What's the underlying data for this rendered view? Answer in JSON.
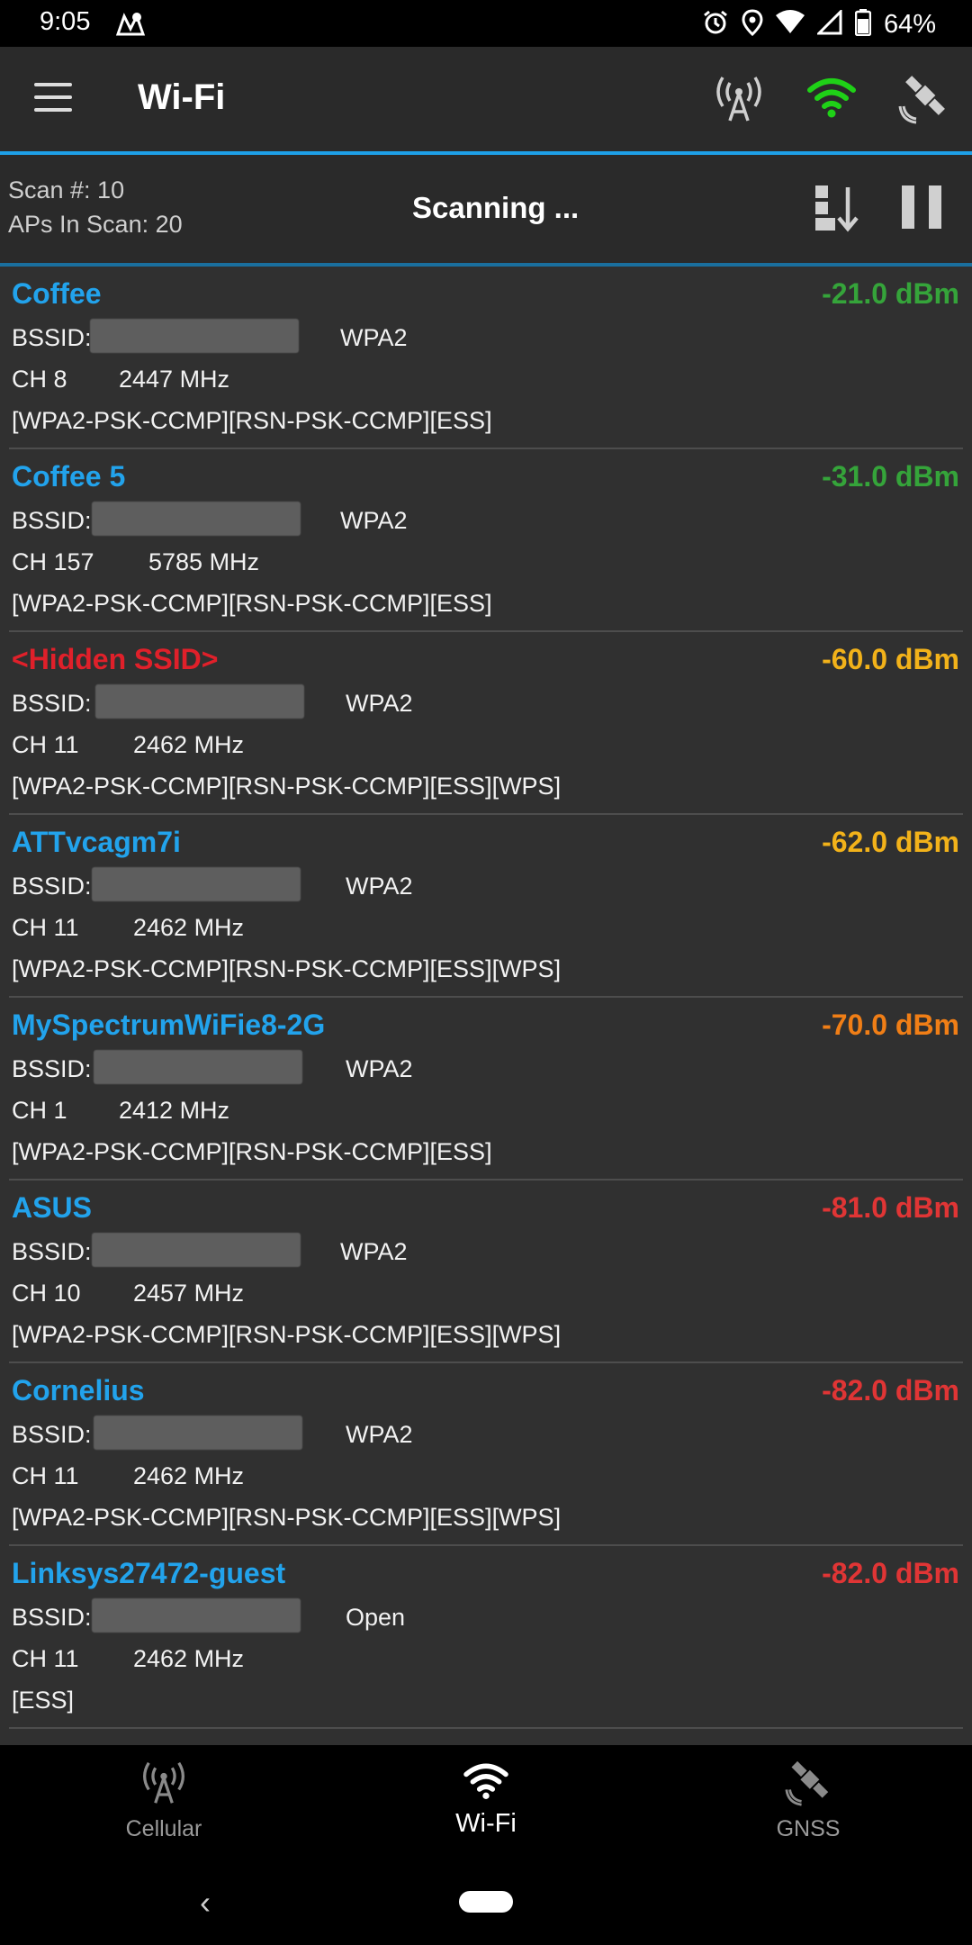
{
  "status_bar": {
    "time": "9:05",
    "battery": "64%",
    "icons": [
      "maps-icon",
      "alarm-icon",
      "location-icon",
      "wifi-icon",
      "signal-icon",
      "battery-icon"
    ]
  },
  "toolbar": {
    "title": "Wi-Fi",
    "icons": [
      "menu-icon",
      "cell-tower-icon",
      "wifi-icon",
      "satellite-icon"
    ],
    "wifi_color": "#1fd117"
  },
  "scan": {
    "scan_number": "Scan #: 10",
    "aps_in_scan": "APs In Scan: 20",
    "status": "Scanning ...",
    "icons": [
      "sort-icon",
      "pause-icon"
    ]
  },
  "colors": {
    "ssid": "#22a3ec",
    "hidden_ssid": "#e0202a",
    "strong": "#35a43a",
    "medium": "#f2b21a",
    "weak_orange": "#f07e16",
    "weak_red": "#e03535"
  },
  "access_points": [
    {
      "ssid": "Coffee",
      "dbm": "-21.0 dBm",
      "dbm_color": "#35a43a",
      "bssid_label": "BSSID:",
      "security": "WPA2",
      "channel": "CH 8",
      "frequency": "2447 MHz",
      "capabilities": "[WPA2-PSK-CCMP][RSN-PSK-CCMP][ESS]",
      "hidden": false
    },
    {
      "ssid": "Coffee 5",
      "dbm": "-31.0 dBm",
      "dbm_color": "#35a43a",
      "bssid_label": "BSSID:",
      "security": "WPA2",
      "channel": "CH 157",
      "frequency": "5785 MHz",
      "capabilities": "[WPA2-PSK-CCMP][RSN-PSK-CCMP][ESS]",
      "hidden": false
    },
    {
      "ssid": "<Hidden SSID>",
      "dbm": "-60.0 dBm",
      "dbm_color": "#f2b21a",
      "bssid_label": "BSSID:",
      "security": "WPA2",
      "channel": "CH 11",
      "frequency": "2462 MHz",
      "capabilities": "[WPA2-PSK-CCMP][RSN-PSK-CCMP][ESS][WPS]",
      "hidden": true
    },
    {
      "ssid": "ATTvcagm7i",
      "dbm": "-62.0 dBm",
      "dbm_color": "#f2b21a",
      "bssid_label": "BSSID:",
      "security": "WPA2",
      "channel": "CH 11",
      "frequency": "2462 MHz",
      "capabilities": "[WPA2-PSK-CCMP][RSN-PSK-CCMP][ESS][WPS]",
      "hidden": false
    },
    {
      "ssid": "MySpectrumWiFie8-2G",
      "dbm": "-70.0 dBm",
      "dbm_color": "#f07e16",
      "bssid_label": "BSSID:",
      "security": "WPA2",
      "channel": "CH 1",
      "frequency": "2412 MHz",
      "capabilities": "[WPA2-PSK-CCMP][RSN-PSK-CCMP][ESS]",
      "hidden": false
    },
    {
      "ssid": "ASUS",
      "dbm": "-81.0 dBm",
      "dbm_color": "#e03535",
      "bssid_label": "BSSID:",
      "security": "WPA2",
      "channel": "CH 10",
      "frequency": "2457 MHz",
      "capabilities": "[WPA2-PSK-CCMP][RSN-PSK-CCMP][ESS][WPS]",
      "hidden": false
    },
    {
      "ssid": "Cornelius",
      "dbm": "-82.0 dBm",
      "dbm_color": "#e03535",
      "bssid_label": "BSSID:",
      "security": "WPA2",
      "channel": "CH 11",
      "frequency": "2462 MHz",
      "capabilities": "[WPA2-PSK-CCMP][RSN-PSK-CCMP][ESS][WPS]",
      "hidden": false
    },
    {
      "ssid": "Linksys27472-guest",
      "dbm": "-82.0 dBm",
      "dbm_color": "#e03535",
      "bssid_label": "BSSID:",
      "security": "Open",
      "channel": "CH 11",
      "frequency": "2462 MHz",
      "capabilities": "[ESS]",
      "hidden": false
    }
  ],
  "bottom_nav": {
    "items": [
      {
        "label": "Cellular",
        "icon": "cell-tower-icon",
        "active": false
      },
      {
        "label": "Wi-Fi",
        "icon": "wifi-icon",
        "active": true
      },
      {
        "label": "GNSS",
        "icon": "satellite-icon",
        "active": false
      }
    ]
  }
}
